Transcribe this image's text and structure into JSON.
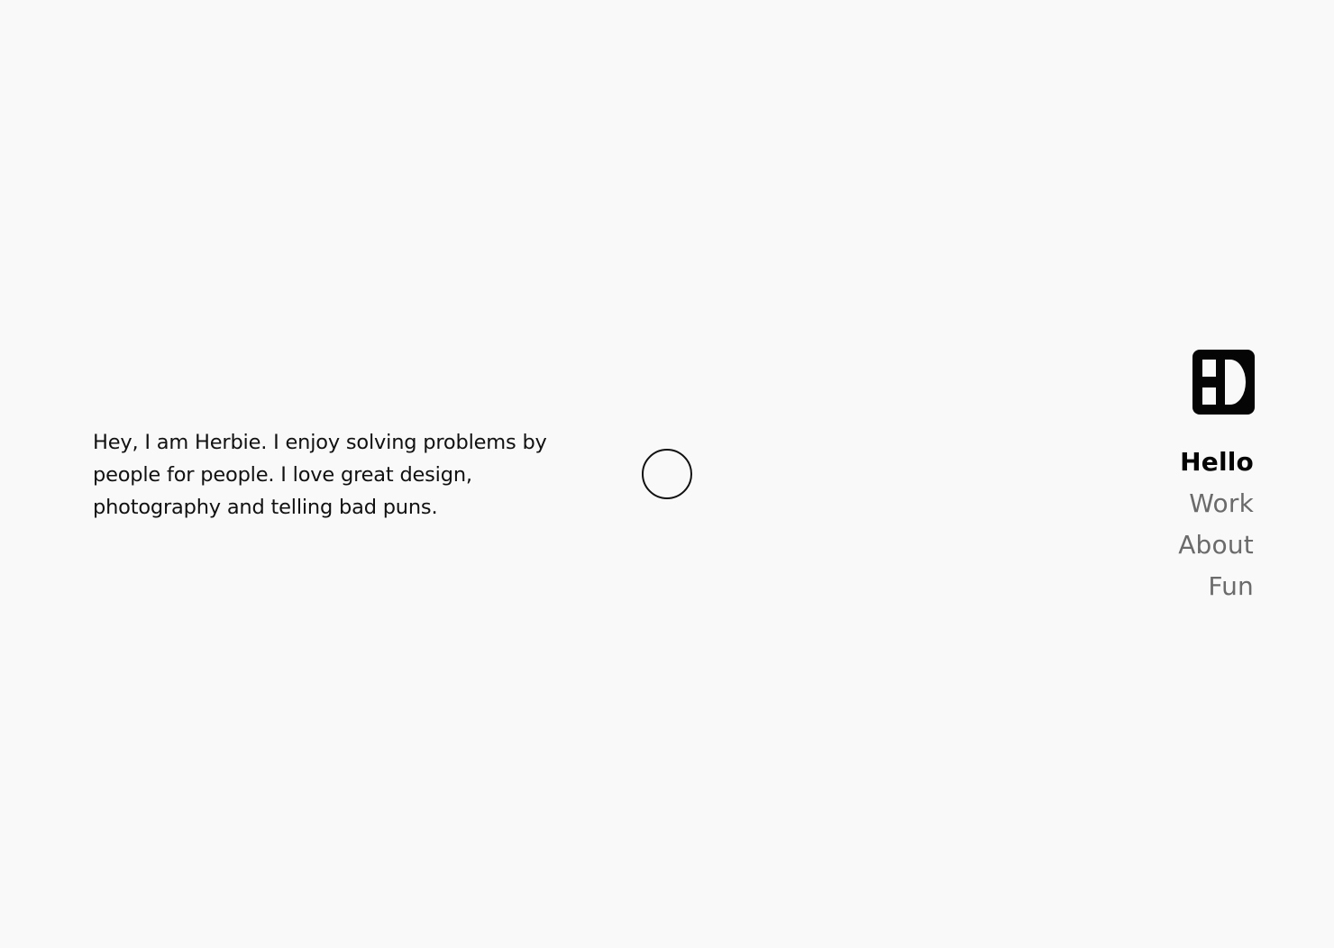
{
  "intro": {
    "text": "Hey, I am Herbie. I enjoy solving problems by people for people. I love great design, photography and telling bad puns."
  },
  "logo": {
    "icon": "hd-monogram-logo",
    "color": "#050505"
  },
  "nav": {
    "items": [
      {
        "label": "Hello",
        "active": true
      },
      {
        "label": "Work",
        "active": false
      },
      {
        "label": "About",
        "active": false
      },
      {
        "label": "Fun",
        "active": false
      }
    ]
  },
  "colors": {
    "background": "#f9f9f9",
    "text": "#111111",
    "nav_inactive": "#6b6b6b",
    "nav_active": "#050505"
  }
}
